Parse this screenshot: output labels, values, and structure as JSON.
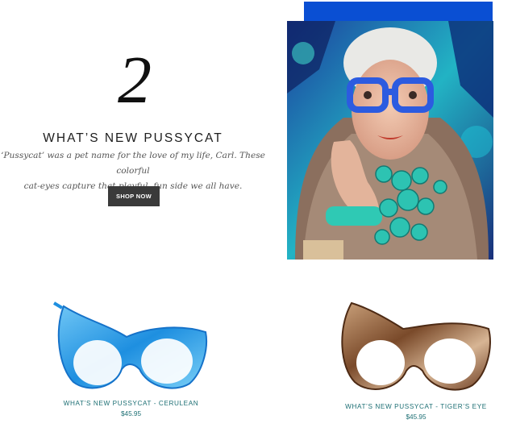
{
  "feature": {
    "number": "2",
    "title": "WHAT’S NEW PUSSYCAT",
    "description_line1": "‘Pussycat’ was a pet name for the love of my life, Carl. These colorful",
    "description_line2": "cat-eyes capture that playful, fun side we all have.",
    "cta_label": "SHOP NOW"
  },
  "colors": {
    "accent_blue": "#0a4fd3",
    "teal_text": "#1d6f74",
    "button_bg": "#3a3a3a"
  },
  "products": [
    {
      "name": "WHAT’S NEW PUSSYCAT - CERULEAN",
      "price": "$45.95"
    },
    {
      "name": "WHAT’S NEW PUSSYCAT - TIGER’S EYE",
      "price": "$45.95"
    }
  ]
}
